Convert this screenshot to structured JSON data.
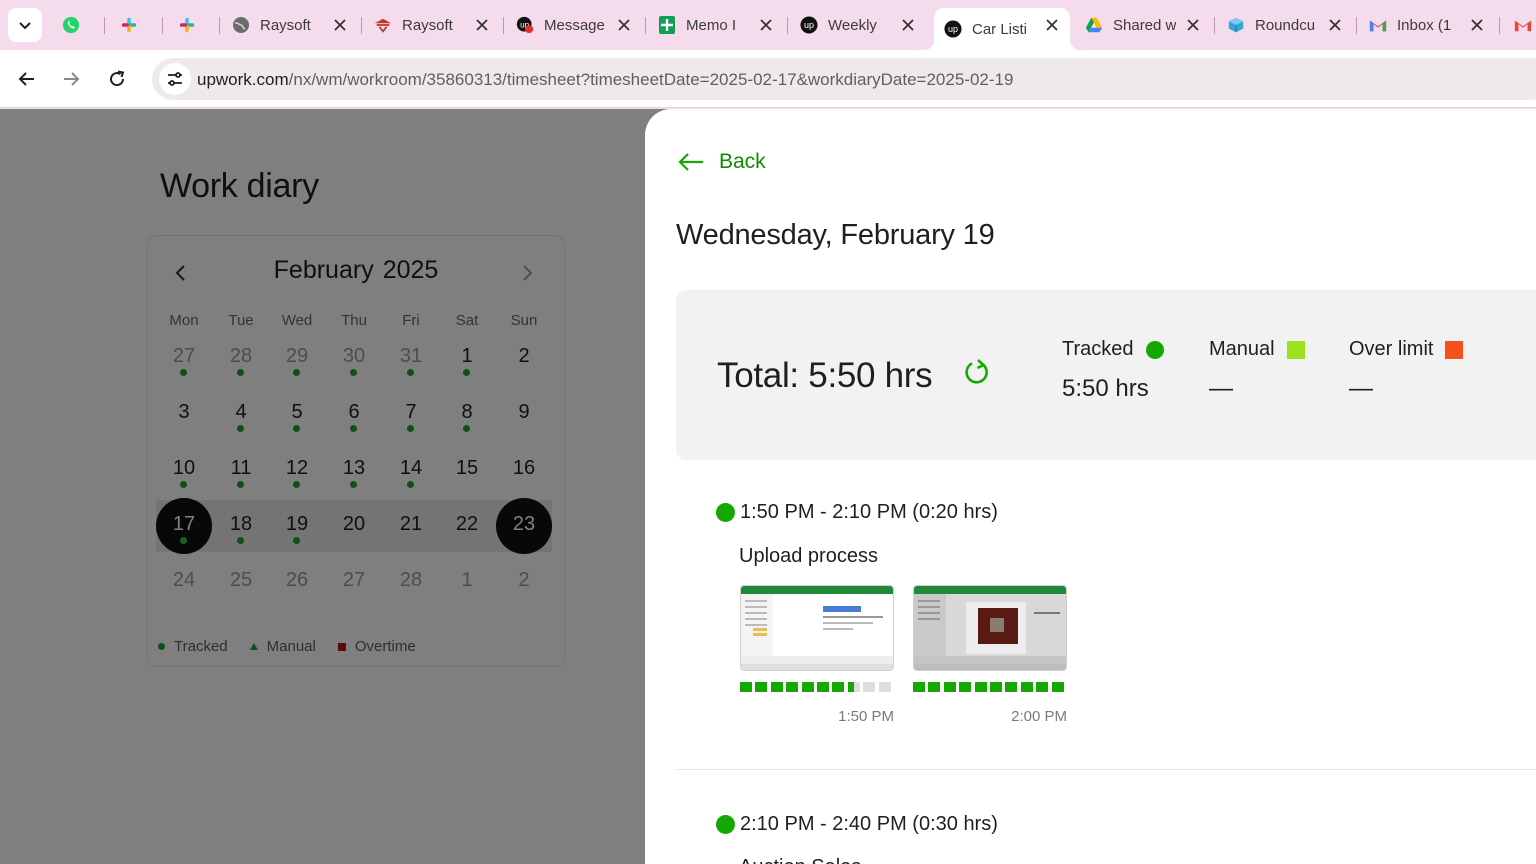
{
  "browser": {
    "tabs": [
      {
        "title": "",
        "icon": "whatsapp-icon"
      },
      {
        "title": "",
        "icon": "slack-icon"
      },
      {
        "title": "",
        "icon": "slack-icon"
      },
      {
        "title": "Raysoft",
        "icon": "globe-icon"
      },
      {
        "title": "Raysoft",
        "icon": "raysoft-icon"
      },
      {
        "title": "Message",
        "icon": "upwork-messages-icon"
      },
      {
        "title": "Memo I",
        "icon": "sheets-icon"
      },
      {
        "title": "Weekly",
        "icon": "upwork-icon"
      },
      {
        "title": "Car Listi",
        "icon": "upwork-icon",
        "active": true
      },
      {
        "title": "Shared w",
        "icon": "google-drive-icon"
      },
      {
        "title": "Roundcu",
        "icon": "roundcube-icon"
      },
      {
        "title": "Inbox (1",
        "icon": "gmail-icon"
      }
    ],
    "url_host": "upwork.com",
    "url_path": "/nx/wm/workroom/35860313/timesheet?timesheetDate=2025-02-17&workdiaryDate=2025-02-19"
  },
  "workdiary": {
    "title": "Work diary",
    "calendar": {
      "month": "February",
      "year": "2025",
      "weekdays": [
        "Mon",
        "Tue",
        "Wed",
        "Thu",
        "Fri",
        "Sat",
        "Sun"
      ],
      "weeks": [
        [
          {
            "d": "27",
            "muted": true,
            "dot": true
          },
          {
            "d": "28",
            "muted": true,
            "dot": true
          },
          {
            "d": "29",
            "muted": true,
            "dot": true
          },
          {
            "d": "30",
            "muted": true,
            "dot": true
          },
          {
            "d": "31",
            "muted": true,
            "dot": true
          },
          {
            "d": "1",
            "dot": true
          },
          {
            "d": "2"
          }
        ],
        [
          {
            "d": "3"
          },
          {
            "d": "4",
            "dot": true
          },
          {
            "d": "5",
            "dot": true
          },
          {
            "d": "6",
            "dot": true
          },
          {
            "d": "7",
            "dot": true
          },
          {
            "d": "8",
            "dot": true
          },
          {
            "d": "9"
          }
        ],
        [
          {
            "d": "10",
            "dot": true
          },
          {
            "d": "11",
            "dot": true
          },
          {
            "d": "12",
            "dot": true
          },
          {
            "d": "13",
            "dot": true
          },
          {
            "d": "14",
            "dot": true
          },
          {
            "d": "15"
          },
          {
            "d": "16"
          }
        ],
        [
          {
            "d": "17",
            "dot": true,
            "selected": true
          },
          {
            "d": "18",
            "dot": true
          },
          {
            "d": "19",
            "dot": true
          },
          {
            "d": "20"
          },
          {
            "d": "21"
          },
          {
            "d": "22"
          },
          {
            "d": "23",
            "selected": true
          }
        ],
        [
          {
            "d": "24",
            "muted": true
          },
          {
            "d": "25",
            "muted": true
          },
          {
            "d": "26",
            "muted": true
          },
          {
            "d": "27",
            "muted": true
          },
          {
            "d": "28",
            "muted": true
          },
          {
            "d": "1",
            "muted": true
          },
          {
            "d": "2",
            "muted": true
          }
        ]
      ],
      "legend": {
        "tracked": "Tracked",
        "manual": "Manual",
        "overtime": "Overtime"
      }
    }
  },
  "detail": {
    "back_label": "Back",
    "date_title": "Wednesday, February 19",
    "total": "Total: 5:50 hrs",
    "stats": {
      "tracked_label": "Tracked",
      "tracked_value": "5:50 hrs",
      "manual_label": "Manual",
      "manual_value": "—",
      "over_label": "Over limit",
      "over_value": "—"
    },
    "colors": {
      "tracked": "#14a800",
      "manual": "#9ae21c",
      "over": "#f5511d",
      "accent": "#108a00"
    },
    "segments": [
      {
        "time": "1:50 PM - 2:10 PM (0:20 hrs)",
        "memo": "Upload process",
        "shots": [
          {
            "time": "1:50 PM",
            "activity": [
              1,
              1,
              1,
              1,
              1,
              1,
              1,
              0.5,
              0,
              0
            ]
          },
          {
            "time": "2:00 PM",
            "activity": [
              1,
              1,
              1,
              1,
              1,
              1,
              1,
              1,
              1,
              1
            ]
          }
        ]
      },
      {
        "time": "2:10 PM - 2:40 PM (0:30 hrs)",
        "memo": "Auction Sales"
      }
    ]
  }
}
